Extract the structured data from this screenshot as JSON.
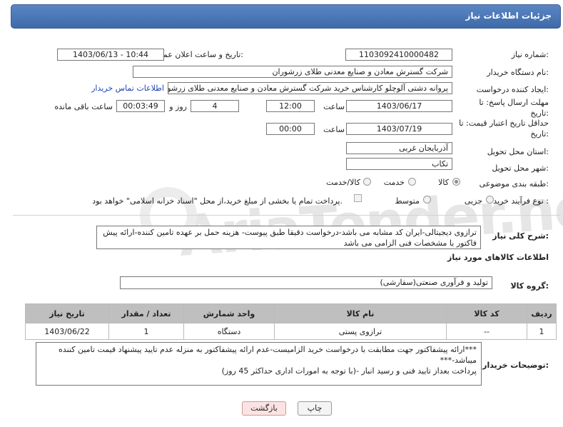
{
  "header": {
    "title": "جزئیات اطلاعات نیاز"
  },
  "watermark": {
    "text": "AriaTender.neT"
  },
  "form": {
    "need_number_label": "شماره نیاز:",
    "need_number": "1103092410000482",
    "announce_label": "تاریخ و ساعت اعلان عمومی:",
    "announce_value": "1403/06/13 - 10:44",
    "buyer_org_label": "نام دستگاه خریدار:",
    "buyer_org": "شرکت گسترش معادن و صنایع معدنی طلای زرشوران",
    "requester_label": "ایجاد کننده درخواست:",
    "requester": "پروانه  دشتی آلوچلو کارشناس خرید شرکت گسترش معادن و صنایع معدنی طلای زرشوران",
    "contact_link": "اطلاعات تماس خریدار",
    "deadline_label_1": "مهلت ارسال پاسخ: تا",
    "deadline_label_2": "تاریخ:",
    "deadline_date": "1403/06/17",
    "time_label": "ساعت",
    "deadline_time": "12:00",
    "days_value": "4",
    "days_label": "روز و",
    "remaining_value": "00:03:49",
    "remaining_label": "ساعت باقی مانده",
    "validity_label_1": "حداقل تاریخ اعتبار قیمت: تا",
    "validity_label_2": "تاریخ:",
    "validity_date": "1403/07/19",
    "validity_time": "00:00",
    "province_label": "استان محل تحویل:",
    "province": "آذربایجان غربی",
    "city_label": "شهر محل تحویل:",
    "city": "تکاب",
    "category_label": "طبقه بندی موضوعی:",
    "category_options": [
      "کالا",
      "خدمت",
      "کالا/خدمت"
    ],
    "category_selected": "کالا",
    "process_label": "نوع فرآیند خرید :",
    "process_options": [
      "جزیی",
      "متوسط"
    ],
    "payment_note": "پرداخت تمام یا بخشی از مبلغ خرید،از محل \"اسناد خزانه اسلامی\" خواهد بود."
  },
  "description": {
    "label": "شرح کلی نیاز:",
    "text": "ترازوی دیجیتالی-ایران کد مشابه می باشد-درخواست دقیقا طبق پیوست- هزینه حمل بر عهده تامین کننده-ارائه پیش فاکتور با مشخصات فنی الزامی می باشد"
  },
  "goods": {
    "section_title": "اطلاعات کالاهای مورد نیاز",
    "group_label": "گروه کالا:",
    "group_value": "تولید و فرآوری صنعتی(سفارشی)",
    "table": {
      "headers": [
        "ردیف",
        "کد کالا",
        "نام کالا",
        "واحد شمارش",
        "تعداد / مقدار",
        "تاریخ نیاز"
      ],
      "rows": [
        [
          "1",
          "--",
          "ترازوی پستی",
          "دستگاه",
          "1",
          "1403/06/22"
        ]
      ]
    }
  },
  "buyer_notes": {
    "label": "توضیحات خریدار:",
    "line1": "***ارائه پیشفاکتور جهت مطابقت با درخواست خرید الزامیست-عدم ارائه پیشفاکتور به منزله عدم تایید پیشنهاد قیمت تامین کننده میباشد-***",
    "line2": "پرداخت بعداز تایید فنی و رسید انبار -(با توجه به امورات اداری حداکثر 45 روز)"
  },
  "buttons": {
    "print": "چاپ",
    "back": "بازگشت"
  }
}
